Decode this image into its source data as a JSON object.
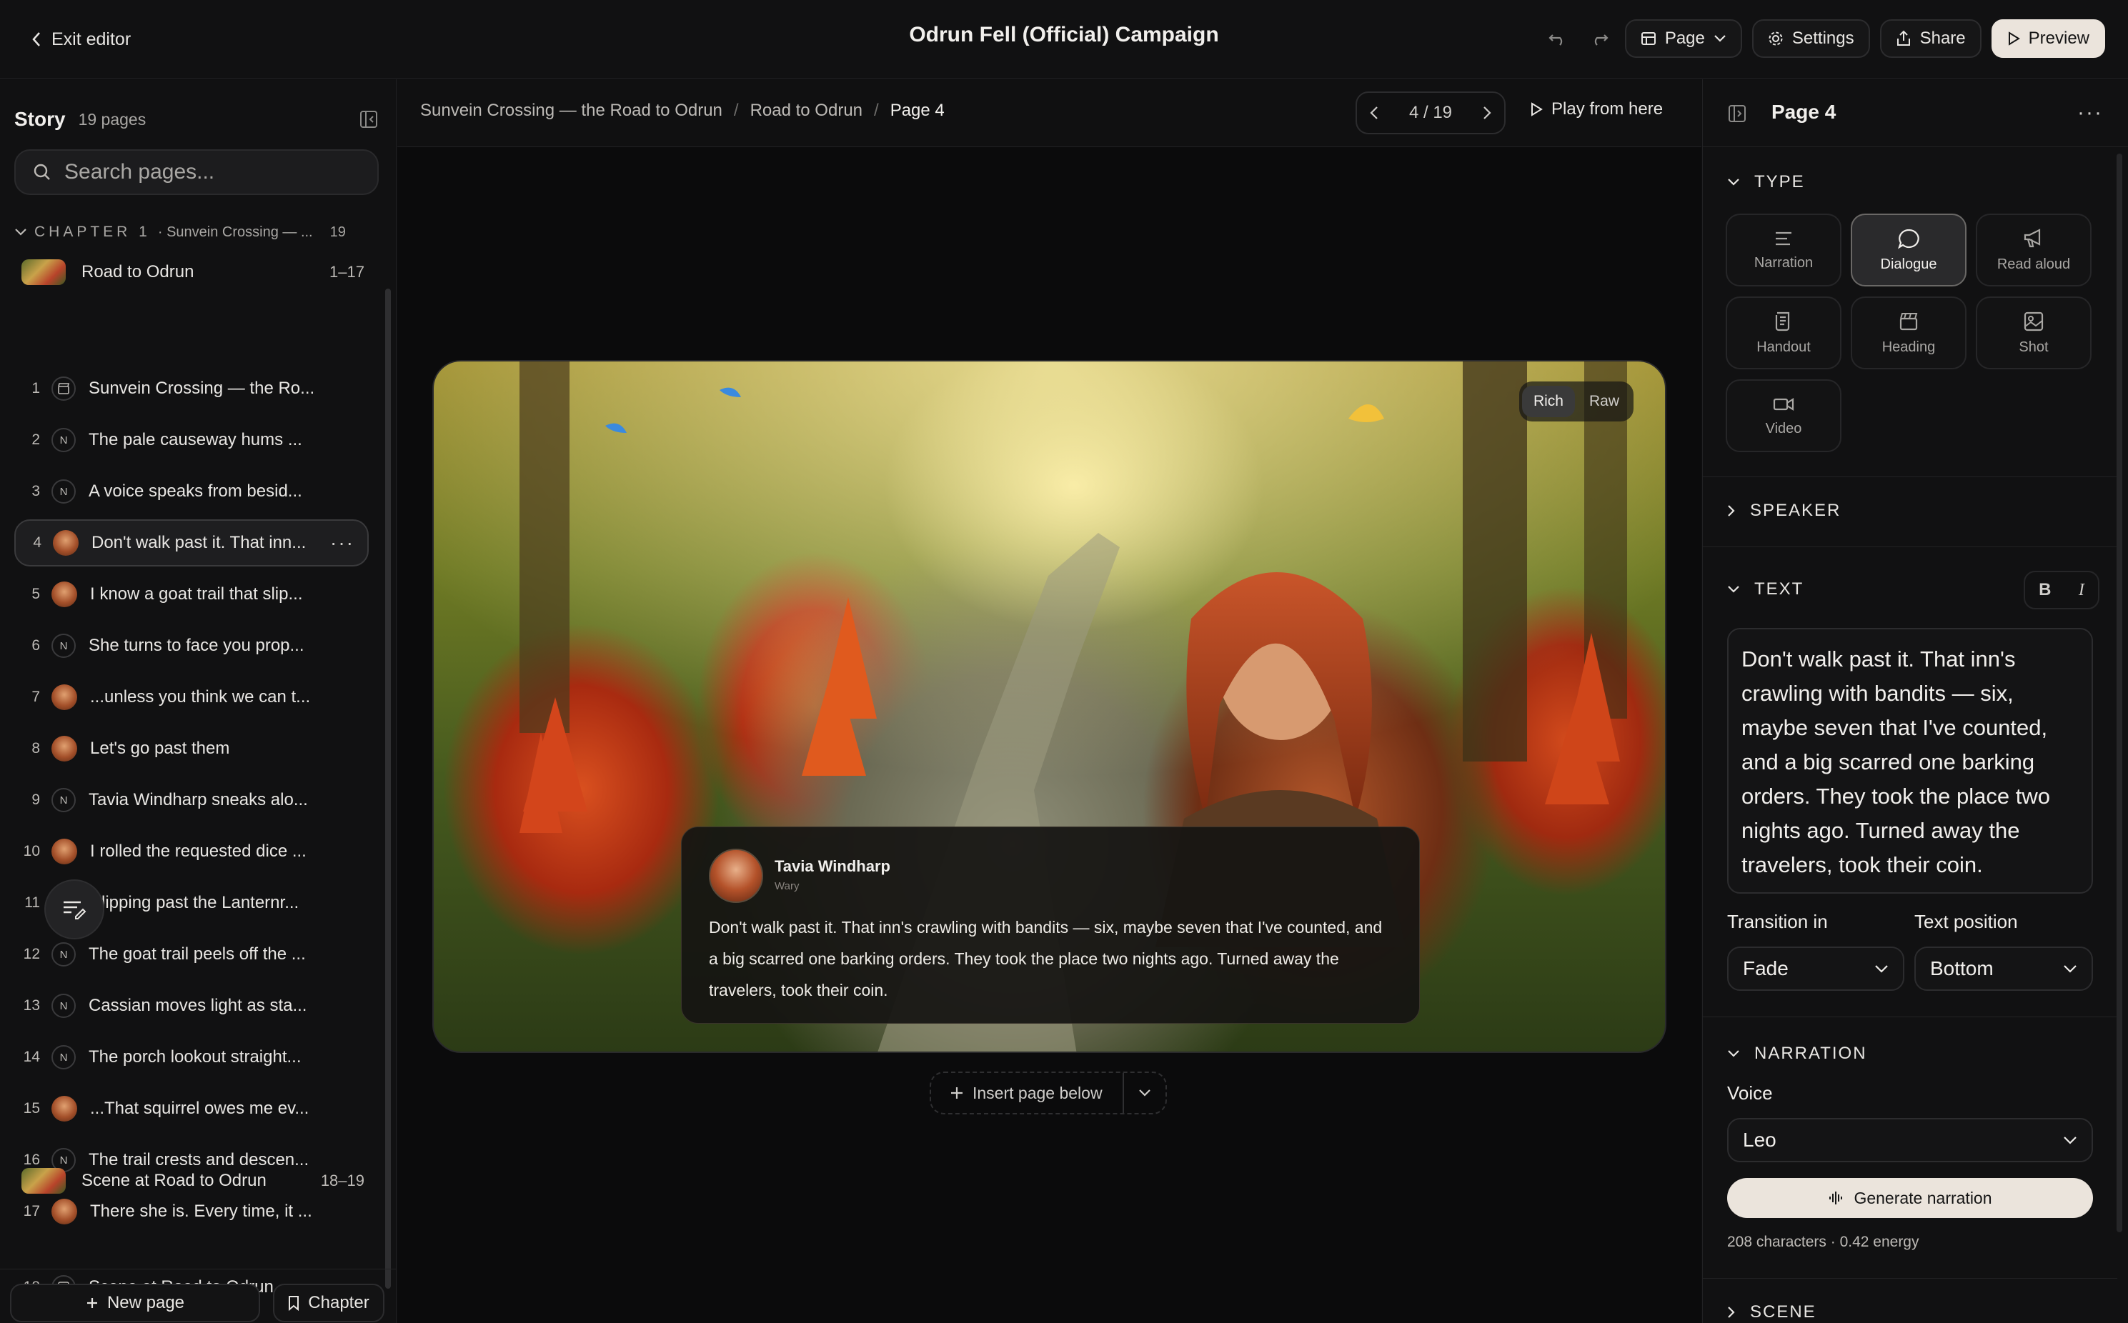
{
  "topbar": {
    "exit_label": "Exit editor",
    "title": "Odrun Fell (Official) Campaign",
    "page_label": "Page",
    "settings_label": "Settings",
    "share_label": "Share",
    "preview_label": "Preview"
  },
  "sidebar": {
    "title": "Story",
    "count": "19 pages",
    "search_placeholder": "Search pages...",
    "chapter": {
      "caption": "CHAPTER 1",
      "name": "· Sunvein Crossing — ...",
      "count": "19"
    },
    "groups": [
      {
        "label": "Road to Odrun",
        "range": "1–17"
      },
      {
        "label": "Scene at Road to Odrun",
        "range": "18–19"
      }
    ],
    "pages": [
      {
        "num": "1",
        "badge": "",
        "label": "Sunvein Crossing — the Ro..."
      },
      {
        "num": "2",
        "badge": "N",
        "label": "The pale causeway hums ..."
      },
      {
        "num": "3",
        "badge": "N",
        "label": "A voice speaks from besid..."
      },
      {
        "num": "4",
        "badge": "",
        "label": "Don't walk past it. That inn..."
      },
      {
        "num": "5",
        "badge": "",
        "label": "I know a goat trail that slip..."
      },
      {
        "num": "6",
        "badge": "N",
        "label": "She turns to face you prop..."
      },
      {
        "num": "7",
        "badge": "",
        "label": "...unless you think we can t..."
      },
      {
        "num": "8",
        "badge": "",
        "label": "Let's go past them"
      },
      {
        "num": "9",
        "badge": "N",
        "label": "Tavia Windharp sneaks alo..."
      },
      {
        "num": "10",
        "badge": "",
        "label": "I rolled the requested dice ..."
      },
      {
        "num": "11",
        "badge": "",
        "label": "Slipping past the Lanternr..."
      },
      {
        "num": "12",
        "badge": "N",
        "label": "The goat trail peels off the ..."
      },
      {
        "num": "13",
        "badge": "N",
        "label": "Cassian moves light as sta..."
      },
      {
        "num": "14",
        "badge": "N",
        "label": "The porch lookout straight..."
      },
      {
        "num": "15",
        "badge": "",
        "label": "...That squirrel owes me ev..."
      },
      {
        "num": "16",
        "badge": "N",
        "label": "The trail crests and descen..."
      },
      {
        "num": "17",
        "badge": "",
        "label": "There she is. Every time, it ..."
      },
      {
        "num": "18",
        "badge": "",
        "label": "Scene at Road to Odrun"
      }
    ],
    "new_page_label": "New page",
    "chapter_label": "Chapter"
  },
  "center": {
    "breadcrumbs": [
      "Sunvein Crossing — the Road to Odrun",
      "Road to Odrun",
      "Page 4"
    ],
    "pager": "4 / 19",
    "play_label": "Play from here",
    "view_modes": [
      "Rich",
      "Raw"
    ],
    "dialogue": {
      "speaker": "Tavia Windharp",
      "mood": "Wary",
      "text": "Don't walk past it. That inn's crawling with bandits — six, maybe seven that I've counted, and a big scarred one barking orders. They took the place two nights ago. Turned away the travelers, took their coin."
    },
    "insert_label": "Insert page below"
  },
  "panel": {
    "title": "Page 4",
    "type_heading": "TYPE",
    "types": [
      "Narration",
      "Dialogue",
      "Read aloud",
      "Handout",
      "Heading",
      "Shot",
      "Video"
    ],
    "selected_type": "Dialogue",
    "speaker_heading": "SPEAKER",
    "text_heading": "TEXT",
    "bold_label": "B",
    "italic_label": "I",
    "text_value": "Don't walk past it. That inn's crawling with bandits — six, maybe seven that I've counted, and a big scarred one barking orders. They took the place two nights ago. Turned away the travelers, took their coin.",
    "transition_label": "Transition in",
    "transition_value": "Fade",
    "position_label": "Text position",
    "position_value": "Bottom",
    "narration_heading": "NARRATION",
    "voice_label": "Voice",
    "voice_value": "Leo",
    "generate_label": "Generate narration",
    "meta": "208 characters · 0.42 energy",
    "scene_heading": "SCENE"
  }
}
